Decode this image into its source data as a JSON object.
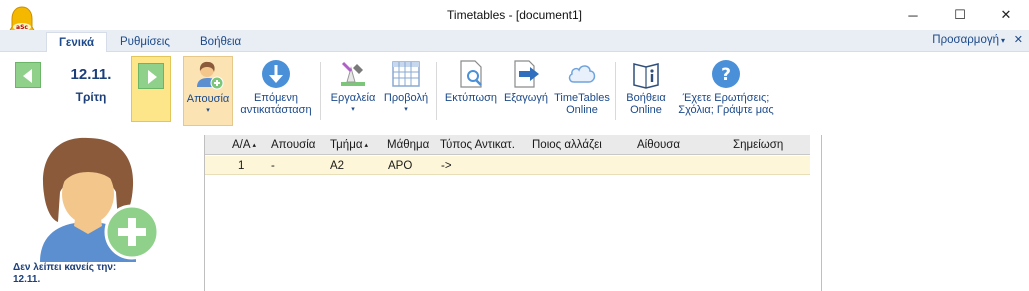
{
  "window": {
    "title": "Timetables - [document1]",
    "minimize_glyph": "─",
    "maximize_glyph": "☐",
    "close_glyph": "✕"
  },
  "app_icon": {
    "label": "aSc",
    "icon": "bell-icon",
    "color": "#f5b800"
  },
  "tabs": {
    "general": "Γενικά",
    "settings": "Ρυθμίσεις",
    "help": "Βοήθεια"
  },
  "customize": {
    "label": "Προσαρμογή",
    "caret": "▾",
    "close": "✕"
  },
  "date_nav": {
    "date": "12.11.",
    "day": "Τρίτη"
  },
  "ribbon": {
    "absence": "Απουσία",
    "absence_caret": "▾",
    "next_sub_1": "Επόμενη",
    "next_sub_2": "αντικατάσταση",
    "tools": "Εργαλεία",
    "tools_caret": "▾",
    "view": "Προβολή",
    "view_caret": "▾",
    "print": "Εκτύπωση",
    "export": "Εξαγωγή",
    "online_1": "TimeTables",
    "online_2": "Online",
    "help_online_1": "Βοήθεια",
    "help_online_2": "Online",
    "faq_1": "Έχετε Ερωτήσεις;",
    "faq_2": "Σχόλια; Γράψτε μας"
  },
  "left_panel": {
    "message_1": "Δεν λείπει κανείς την:",
    "message_2": "12.11."
  },
  "table": {
    "headers": {
      "aa": "Α/Α",
      "absence": "Απουσία",
      "class": "Τμήμα",
      "subject": "Μάθημα",
      "sub_type": "Τύπος Αντικατ.",
      "who_changes": "Ποιος αλλάζει",
      "room": "Αίθουσα",
      "note": "Σημείωση"
    },
    "sort_glyph": "▴",
    "rows": [
      {
        "aa": "1",
        "absence": "-",
        "class": "A2",
        "subject": "ΑΡΟ",
        "sub_type": "->"
      }
    ]
  },
  "colors": {
    "accent": "#1c4a8a",
    "nav_green": "#8fd18a",
    "highlight_yellow": "#fde68a",
    "row_yellow": "#fdf6d8"
  }
}
